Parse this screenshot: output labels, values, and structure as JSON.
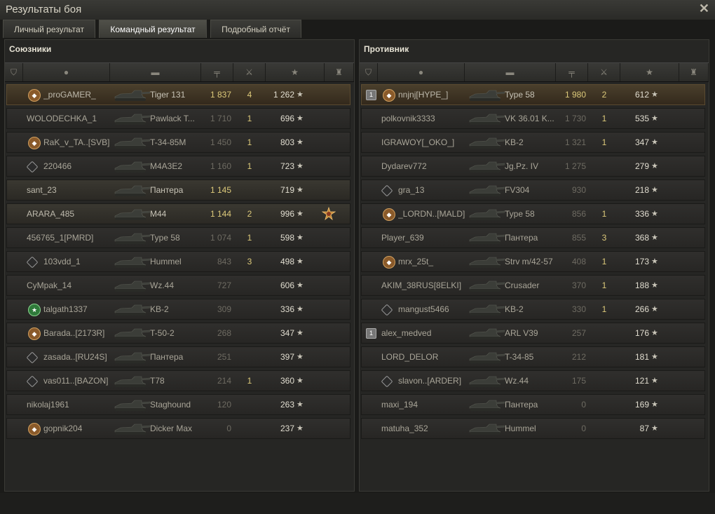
{
  "window": {
    "title": "Результаты боя",
    "close_icon": "close-icon"
  },
  "tabs": [
    {
      "label": "Личный результат",
      "active": false
    },
    {
      "label": "Командный результат",
      "active": true
    },
    {
      "label": "Подробный отчёт",
      "active": false
    }
  ],
  "allies": {
    "title": "Союзники",
    "rows": [
      {
        "name": "_proGAMER_",
        "tank": "Tiger 131",
        "damage": "1 837",
        "kills": "4",
        "xp": "1 262",
        "badge": "clan",
        "hl": true
      },
      {
        "name": "WOLODECHKA_1",
        "tank": "Pawlack T...",
        "damage": "1 710",
        "kills": "1",
        "xp": "696",
        "dim": true
      },
      {
        "name": "RaK_v_TA..[SVB]",
        "tank": "T-34-85M",
        "damage": "1 450",
        "kills": "1",
        "xp": "803",
        "badge": "clan",
        "dim": true
      },
      {
        "name": "220466",
        "tank": "M4A3E2",
        "damage": "1 160",
        "kills": "1",
        "xp": "723",
        "badge": "diamond",
        "dim": true
      },
      {
        "name": "sant_23",
        "tank": "Пантера",
        "damage": "1 145",
        "kills": "",
        "xp": "719",
        "self": true
      },
      {
        "name": "ARARA_485",
        "tank": "M44",
        "damage": "1 144",
        "kills": "2",
        "xp": "996",
        "medal": true,
        "self": true
      },
      {
        "name": "456765_1[PMRD]",
        "tank": "Type 58",
        "damage": "1 074",
        "kills": "1",
        "xp": "598",
        "dim": true
      },
      {
        "name": "103vdd_1",
        "tank": "Hummel",
        "damage": "843",
        "kills": "3",
        "xp": "498",
        "badge": "diamond",
        "dim": true
      },
      {
        "name": "CyMpak_14",
        "tank": "Wz.44",
        "damage": "727",
        "kills": "",
        "xp": "606",
        "dim": true
      },
      {
        "name": "talgath1337",
        "tank": "KB-2",
        "damage": "309",
        "kills": "",
        "xp": "336",
        "badge": "green",
        "dim": true
      },
      {
        "name": "Barada..[2173R]",
        "tank": "T-50-2",
        "damage": "268",
        "kills": "",
        "xp": "347",
        "badge": "clan",
        "dim": true
      },
      {
        "name": "zasada..[RU24S]",
        "tank": "Пантера",
        "damage": "251",
        "kills": "",
        "xp": "397",
        "badge": "diamond",
        "dim": true
      },
      {
        "name": "vas011..[BAZON]",
        "tank": "T78",
        "damage": "214",
        "kills": "1",
        "xp": "360",
        "badge": "diamond",
        "dim": true
      },
      {
        "name": "nikolaj1961",
        "tank": "Staghound",
        "damage": "120",
        "kills": "",
        "xp": "263",
        "dim": true
      },
      {
        "name": "gopnik204",
        "tank": "Dicker Max",
        "damage": "0",
        "kills": "",
        "xp": "237",
        "badge": "clan",
        "dim": true
      }
    ]
  },
  "enemies": {
    "title": "Противник",
    "rows": [
      {
        "name": "nnjnj[HYPE_]",
        "tank": "Type 58",
        "damage": "1 980",
        "kills": "2",
        "xp": "612",
        "badge": "clan",
        "sq": "1",
        "hl": true
      },
      {
        "name": "polkovnik3333",
        "tank": "VK 36.01 K...",
        "damage": "1 730",
        "kills": "1",
        "xp": "535",
        "dim": true
      },
      {
        "name": "IGRAWOY[_OKO_]",
        "tank": "KB-2",
        "damage": "1 321",
        "kills": "1",
        "xp": "347",
        "dim": true
      },
      {
        "name": "Dydarev772",
        "tank": "Jg.Pz. IV",
        "damage": "1 275",
        "kills": "",
        "xp": "279",
        "dim": true
      },
      {
        "name": "gra_13",
        "tank": "FV304",
        "damage": "930",
        "kills": "",
        "xp": "218",
        "badge": "diamond",
        "dim": true
      },
      {
        "name": "_LORDN..[MALD]",
        "tank": "Type 58",
        "damage": "856",
        "kills": "1",
        "xp": "336",
        "badge": "clan",
        "dim": true
      },
      {
        "name": "Player_639",
        "tank": "Пантера",
        "damage": "855",
        "kills": "3",
        "xp": "368",
        "dim": true
      },
      {
        "name": "mrx_25t_",
        "tank": "Strv m/42-57",
        "damage": "408",
        "kills": "1",
        "xp": "173",
        "badge": "clan",
        "dim": true
      },
      {
        "name": "AKIM_38RUS[8ELKI]",
        "tank": "Crusader",
        "damage": "370",
        "kills": "1",
        "xp": "188",
        "dim": true
      },
      {
        "name": "mangust5466",
        "tank": "KB-2",
        "damage": "330",
        "kills": "1",
        "xp": "266",
        "badge": "diamond",
        "dim": true
      },
      {
        "name": "alex_medved",
        "tank": "ARL V39",
        "damage": "257",
        "kills": "",
        "xp": "176",
        "sq": "1",
        "dim": true
      },
      {
        "name": "LORD_DELOR",
        "tank": "T-34-85",
        "damage": "212",
        "kills": "",
        "xp": "181",
        "dim": true
      },
      {
        "name": "slavon..[ARDER]",
        "tank": "Wz.44",
        "damage": "175",
        "kills": "",
        "xp": "121",
        "badge": "diamond",
        "dim": true
      },
      {
        "name": "maxi_194",
        "tank": "Пантера",
        "damage": "0",
        "kills": "",
        "xp": "169",
        "dim": true
      },
      {
        "name": "matuha_352",
        "tank": "Hummel",
        "damage": "0",
        "kills": "",
        "xp": "87",
        "dim": true
      }
    ]
  },
  "colors": {
    "damage_gold": "#dcc97a",
    "highlight_row": "#4a3f2c"
  }
}
